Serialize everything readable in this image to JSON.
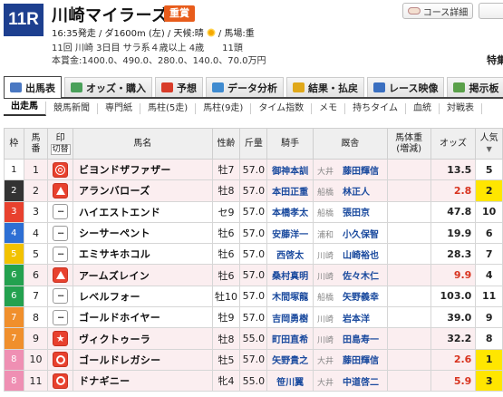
{
  "header": {
    "race_no": "11R",
    "race_name": "川崎マイラーズ",
    "grade": "重賞",
    "info_line1_a": "16:35発走 / ダ1600m (左) / 天候:晴",
    "info_line1_b": "/ 馬場:重",
    "info_line2": "11回 川崎 3日目 サラ系４歳以上 4歳　　11頭",
    "info_line3": "本賞金:1400.0、490.0、280.0、140.0、70.0万円",
    "course_button": "コース詳細",
    "special_label": "特集"
  },
  "tabs": [
    {
      "label": "出馬表",
      "icon": "entries-icon",
      "icon_color": "#4a78c2",
      "active": true
    },
    {
      "label": "オッズ・購入",
      "icon": "odds-icon",
      "icon_color": "#4aa05a",
      "active": false
    },
    {
      "label": "予想",
      "icon": "target-icon",
      "icon_color": "#d83c2a",
      "active": false
    },
    {
      "label": "データ分析",
      "icon": "chart-icon",
      "icon_color": "#3f8bd0",
      "active": false
    },
    {
      "label": "結果・払戻",
      "icon": "coins-icon",
      "icon_color": "#e0a81a",
      "active": false
    },
    {
      "label": "レース映像",
      "icon": "video-icon",
      "icon_color": "#3a6fc0",
      "active": false
    },
    {
      "label": "掲示板",
      "icon": "board-icon",
      "icon_color": "#5aa04a",
      "active": false
    }
  ],
  "subnav": [
    "出走馬",
    "競馬新聞",
    "専門紙",
    "馬柱(5走)",
    "馬柱(9走)",
    "タイム指数",
    "メモ",
    "持ちタイム",
    "血統",
    "対戦表"
  ],
  "columns": {
    "waku": "枠",
    "umaban_1": "馬",
    "umaban_2": "番",
    "mark_1": "印",
    "mark_2": "切替",
    "horse": "馬名",
    "sex_age": "性齢",
    "weight": "斤量",
    "jockey": "騎手",
    "trainer": "厩舎",
    "body_1": "馬体重",
    "body_2": "(増減)",
    "odds": "オッズ",
    "pop_1": "人気",
    "pop_2": "▼"
  },
  "waku_colors": [
    "#ffffff",
    "#333333",
    "#e8412e",
    "#2d6fd4",
    "#f2c200",
    "#23a14f",
    "#f08f2c",
    "#ef8fb3"
  ],
  "rows": [
    {
      "waku": "1",
      "umaban": "1",
      "mark": "double-circle",
      "horse": "ビヨンドザファザー",
      "sex_age": "牡7",
      "weight": "57.0",
      "jockey": "御神本訓",
      "aff": "大井",
      "trainer": "藤田輝信",
      "odds": "13.5",
      "odds_red": false,
      "pop": "5",
      "selected": true,
      "checked": false
    },
    {
      "waku": "2",
      "umaban": "2",
      "mark": "triangle",
      "horse": "アランバローズ",
      "sex_age": "牡8",
      "weight": "57.0",
      "jockey": "本田正重",
      "aff": "船橋",
      "trainer": "林正人",
      "odds": "2.8",
      "odds_red": true,
      "pop": "2",
      "selected": true,
      "checked": true
    },
    {
      "waku": "3",
      "umaban": "3",
      "mark": "none",
      "horse": "ハイエストエンド",
      "sex_age": "セ9",
      "weight": "57.0",
      "jockey": "本橋孝太",
      "aff": "船橋",
      "trainer": "張田京",
      "odds": "47.8",
      "odds_red": false,
      "pop": "10",
      "selected": false,
      "checked": false
    },
    {
      "waku": "4",
      "umaban": "4",
      "mark": "none",
      "horse": "シーサーペント",
      "sex_age": "牡6",
      "weight": "57.0",
      "jockey": "安藤洋一",
      "aff": "浦和",
      "trainer": "小久保智",
      "odds": "19.9",
      "odds_red": false,
      "pop": "6",
      "selected": false,
      "checked": false
    },
    {
      "waku": "5",
      "umaban": "5",
      "mark": "none",
      "horse": "エミサキホコル",
      "sex_age": "牡6",
      "weight": "57.0",
      "jockey": "西啓太",
      "aff": "川崎",
      "trainer": "山崎裕也",
      "odds": "28.3",
      "odds_red": false,
      "pop": "7",
      "selected": false,
      "checked": false
    },
    {
      "waku": "6",
      "umaban": "6",
      "mark": "triangle",
      "horse": "アームズレイン",
      "sex_age": "牡6",
      "weight": "57.0",
      "jockey": "桑村真明",
      "aff": "川崎",
      "trainer": "佐々木仁",
      "odds": "9.9",
      "odds_red": true,
      "pop": "4",
      "selected": true,
      "checked": false
    },
    {
      "waku": "6",
      "umaban": "7",
      "mark": "none",
      "horse": "レベルフォー",
      "sex_age": "牡10",
      "weight": "57.0",
      "jockey": "木間塚龍",
      "aff": "船橋",
      "trainer": "矢野義幸",
      "odds": "103.0",
      "odds_red": false,
      "pop": "11",
      "selected": false,
      "checked": false
    },
    {
      "waku": "7",
      "umaban": "8",
      "mark": "none",
      "horse": "ゴールドホイヤー",
      "sex_age": "牡9",
      "weight": "57.0",
      "jockey": "吉岡勇樹",
      "aff": "川崎",
      "trainer": "岩本洋",
      "odds": "39.0",
      "odds_red": false,
      "pop": "9",
      "selected": false,
      "checked": false
    },
    {
      "waku": "7",
      "umaban": "9",
      "mark": "star",
      "horse": "ヴィクトゥーラ",
      "sex_age": "牡8",
      "weight": "55.0",
      "jockey": "町田直希",
      "aff": "川崎",
      "trainer": "田島寿一",
      "odds": "32.2",
      "odds_red": false,
      "pop": "8",
      "selected": true,
      "checked": false
    },
    {
      "waku": "8",
      "umaban": "10",
      "mark": "circle",
      "horse": "ゴールドレガシー",
      "sex_age": "牡5",
      "weight": "57.0",
      "jockey": "矢野貴之",
      "aff": "大井",
      "trainer": "藤田輝信",
      "odds": "2.6",
      "odds_red": true,
      "pop": "1",
      "selected": true,
      "checked": true
    },
    {
      "waku": "8",
      "umaban": "11",
      "mark": "circle",
      "horse": "ドナギニー",
      "sex_age": "牝4",
      "weight": "55.0",
      "jockey": "笹川翼",
      "aff": "大井",
      "trainer": "中道啓二",
      "odds": "5.9",
      "odds_red": true,
      "pop": "3",
      "selected": true,
      "checked": true
    }
  ]
}
